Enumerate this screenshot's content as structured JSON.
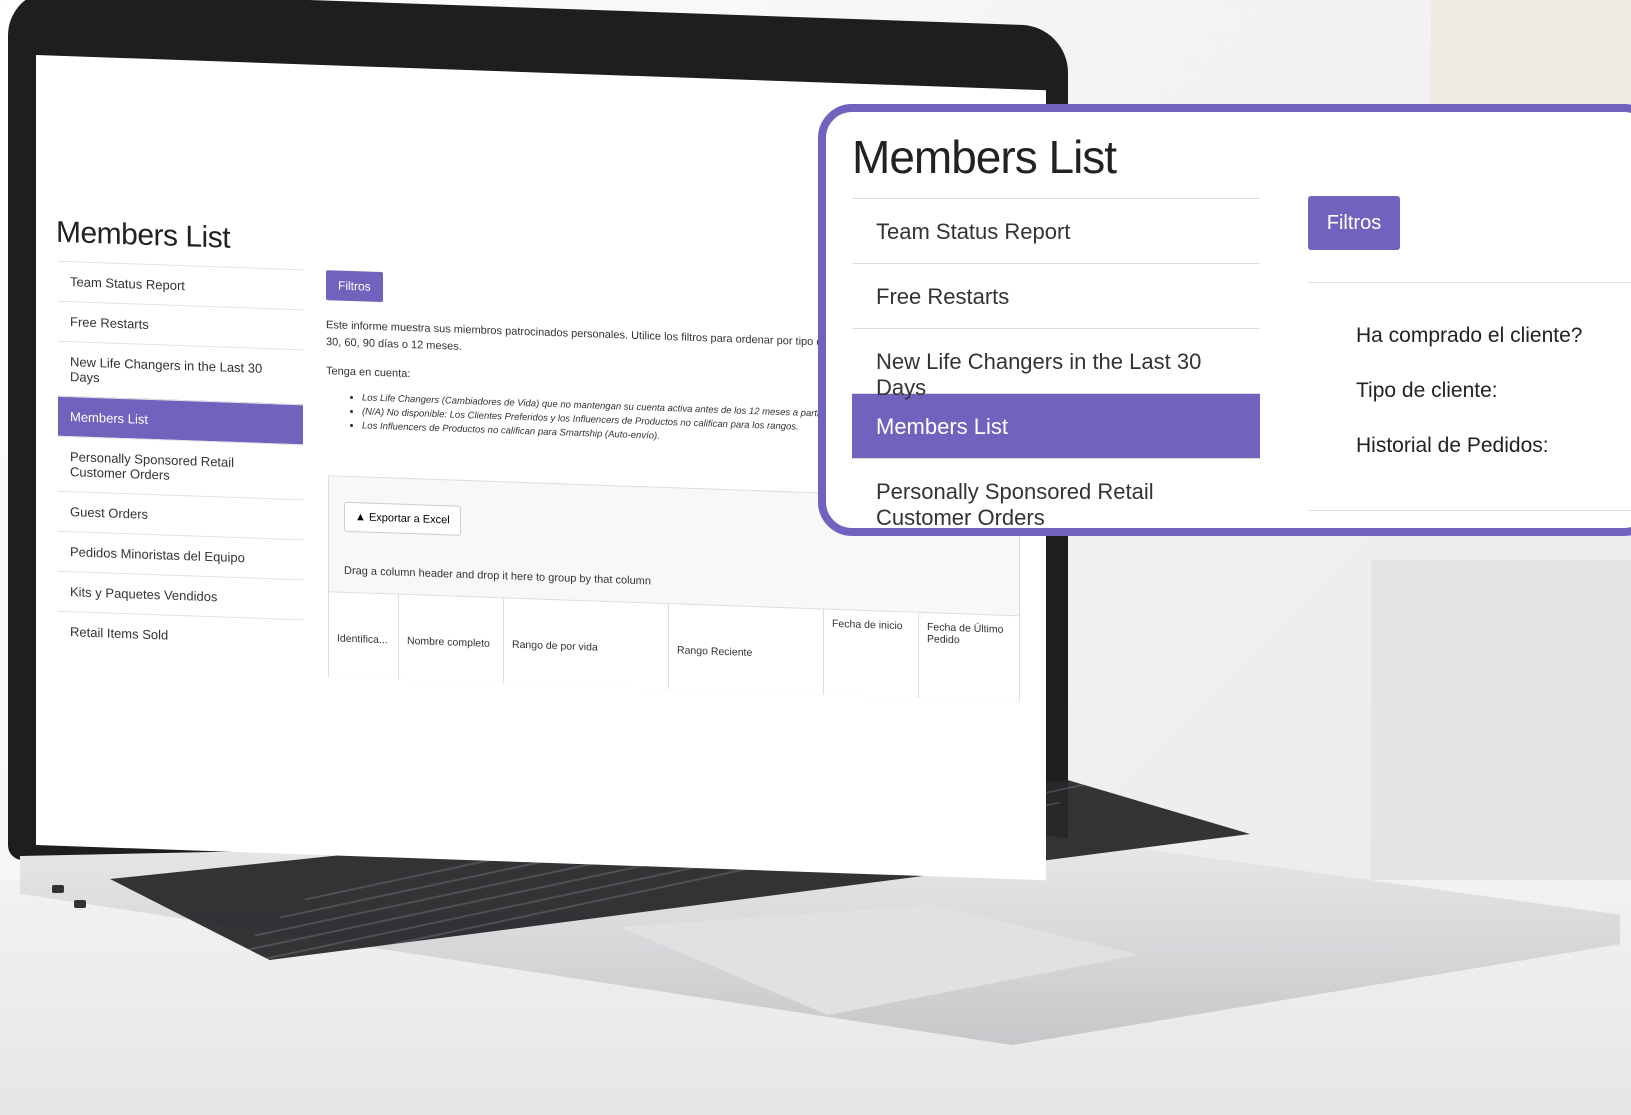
{
  "screen": {
    "title": "Members List",
    "sidebar": [
      {
        "label": "Team Status Report"
      },
      {
        "label": "Free Restarts"
      },
      {
        "label": "New Life Changers in the Last 30 Days"
      },
      {
        "label": "Members List",
        "active": true
      },
      {
        "label": "Personally Sponsored Retail Customer Orders"
      },
      {
        "label": "Guest Orders"
      },
      {
        "label": "Pedidos Minoristas del Equipo"
      },
      {
        "label": "Kits y Paquetes Vendidos"
      },
      {
        "label": "Retail Items Sold"
      }
    ],
    "filter_label": "Filtros",
    "description": "Este informe muestra sus miembros patrocinados personales. Utilice los filtros para ordenar por tipo de cliente y si los compra en los últimos 30, 60, 90 días o 12 meses.",
    "note_heading": "Tenga en cuenta:",
    "bullets": [
      "Los Life Changers (Cambiadores de Vida) que no mantengan su cuenta activa antes de los 12 meses a partir de la fecha abandonada y se eliminará de su lista.",
      "(N/A) No disponible: Los Clientes Preferidos y los Influencers de Productos no califican para los rangos.",
      "Los Influencers de Productos no califican para Smartship (Auto-envío)."
    ],
    "export_label": "Exportar a Excel",
    "group_hint": "Drag a column header and drop it here to group by that column",
    "columns": [
      "Identifica...",
      "Nombre completo",
      "Rango de por vida",
      "Rango Reciente",
      "Fecha de inicio",
      "Fecha de Último Pedido"
    ]
  },
  "callout": {
    "title": "Members List",
    "sidebar": [
      {
        "label": "Team Status Report"
      },
      {
        "label": "Free Restarts"
      },
      {
        "label": "New Life Changers in the Last 30 Days"
      },
      {
        "label": "Members List",
        "active": true
      },
      {
        "label": "Personally Sponsored Retail Customer Orders"
      }
    ],
    "filter_label": "Filtros",
    "filters": [
      "Ha comprado el cliente?",
      "Tipo de cliente:",
      "Historial de Pedidos:"
    ]
  },
  "colors": {
    "accent": "#6f63bd"
  }
}
